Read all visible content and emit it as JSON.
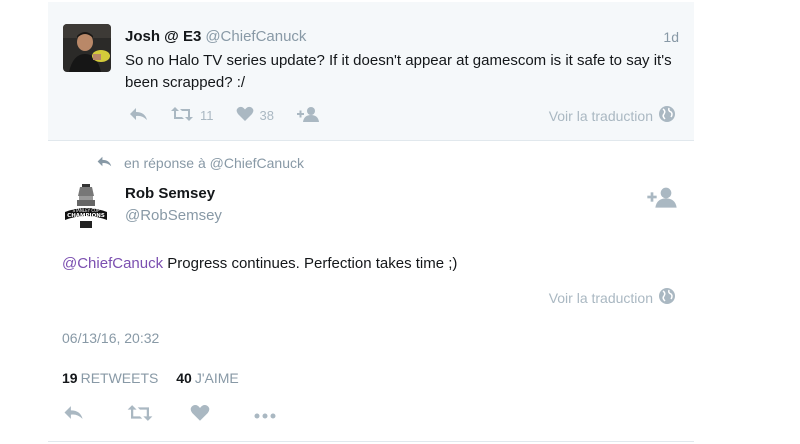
{
  "parent_tweet": {
    "name": "Josh @ E3",
    "handle": "@ChiefCanuck",
    "time": "1d",
    "text": "So no Halo TV series update? If it doesn't appear at gamescom is it safe to say it's been scrapped? :/",
    "retweets": "11",
    "likes": "38",
    "translate": "Voir la traduction"
  },
  "reply_context": {
    "text": "en réponse à @ChiefCanuck"
  },
  "main_tweet": {
    "name": "Rob Semsey",
    "handle": "@RobSemsey",
    "mention": "@ChiefCanuck",
    "text": " Progress continues. Perfection takes time ;)",
    "translate": "Voir la traduction",
    "date": "06/13/16, 20:32",
    "retweets_count": "19",
    "retweets_label": "Retweets",
    "likes_count": "40",
    "likes_label": "J'aime"
  },
  "avatar_text": {
    "rob_line1": "STANLEY CUP",
    "rob_line2": "CHAMPIONS"
  },
  "colors": {
    "mention": "#7b4fb0",
    "muted": "#8899a6",
    "icon": "#aab8c2",
    "parent_bg": "#f5f8fa"
  },
  "icons": {
    "reply": "reply-icon",
    "retweet": "retweet-icon",
    "like": "heart-icon",
    "follow": "follow-icon",
    "globe": "globe-icon",
    "more": "more-icon"
  }
}
